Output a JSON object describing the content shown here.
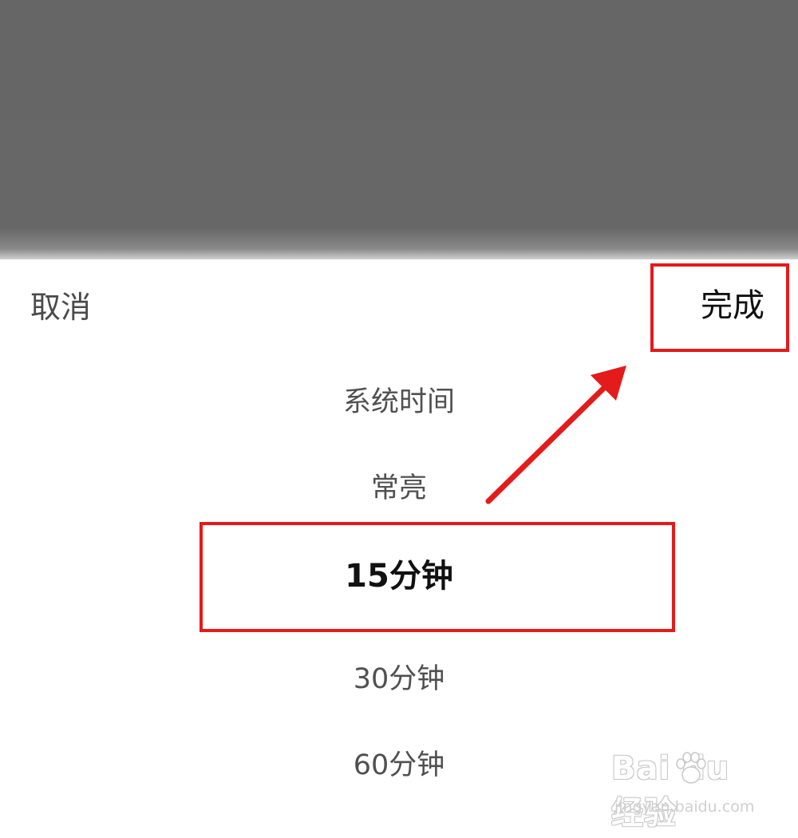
{
  "header": {
    "cancel_label": "取消",
    "done_label": "完成"
  },
  "picker": {
    "options": [
      "系统时间",
      "常亮",
      "15分钟",
      "30分钟",
      "60分钟"
    ],
    "selected_index": 2
  },
  "annotations": {
    "highlight_color": "#e31b1b"
  },
  "watermark": {
    "logo_text": "Bai du 经验",
    "url": "jingyan.baidu.com"
  }
}
